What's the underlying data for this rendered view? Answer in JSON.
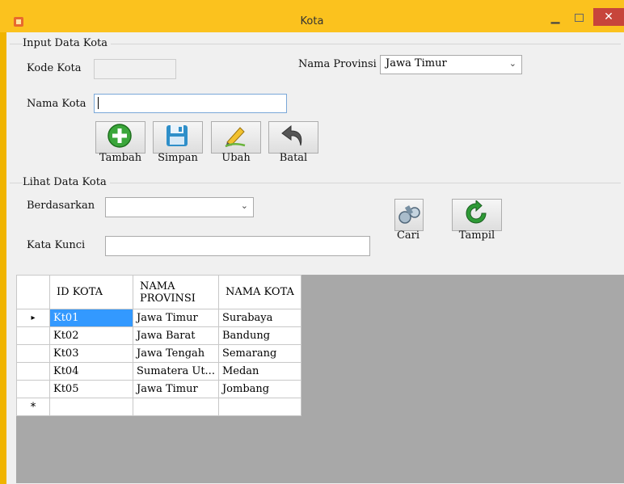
{
  "window": {
    "title": "Kota"
  },
  "input_group": {
    "title": "Input Data Kota",
    "kode_label": "Kode Kota",
    "kode_value": "",
    "nama_label": "Nama Kota",
    "nama_value": "",
    "provinsi_label": "Nama Provinsi",
    "provinsi_value": "Jawa Timur"
  },
  "buttons": {
    "tambah": "Tambah",
    "simpan": "Simpan",
    "ubah": "Ubah",
    "batal": "Batal",
    "cari": "Cari",
    "tampil": "Tampil"
  },
  "search_group": {
    "title": "Lihat Data Kota",
    "berdasarkan_label": "Berdasarkan",
    "berdasarkan_value": "",
    "kunci_label": "Kata Kunci",
    "kunci_value": ""
  },
  "table": {
    "columns": [
      "ID KOTA",
      "NAMA PROVINSI",
      "NAMA KOTA"
    ],
    "rows": [
      [
        "Kt01",
        "Jawa Timur",
        "Surabaya"
      ],
      [
        "Kt02",
        "Jawa Barat",
        "Bandung"
      ],
      [
        "Kt03",
        "Jawa Tengah",
        "Semarang"
      ],
      [
        "Kt04",
        "Sumatera Ut...",
        "Medan"
      ],
      [
        "Kt05",
        "Jawa Timur",
        "Jombang"
      ]
    ],
    "current_row_marker": "▸",
    "new_row_marker": "*"
  },
  "icons": {
    "tambah": "plus-circle-icon",
    "simpan": "save-disk-icon",
    "ubah": "pencil-edit-icon",
    "batal": "undo-arrow-icon",
    "cari": "search-binoculars-icon",
    "tampil": "refresh-icon"
  },
  "colors": {
    "title_bar": "#fbc21e",
    "selection": "#3399ff",
    "close": "#c7453b"
  }
}
